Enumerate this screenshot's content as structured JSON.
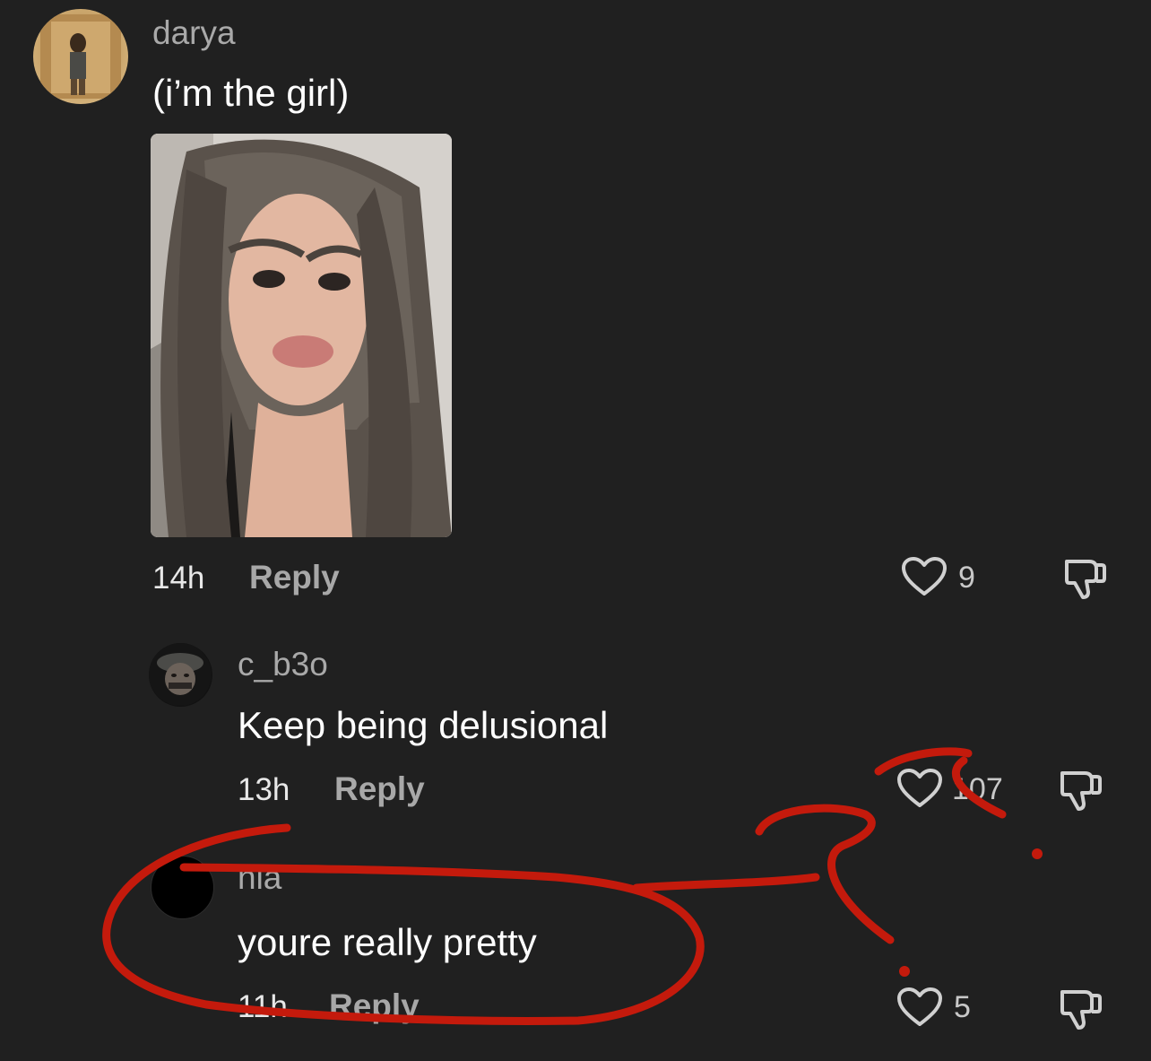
{
  "comments": [
    {
      "username": "darya",
      "text": "(i’m the girl)",
      "time": "14h",
      "reply_label": "Reply",
      "likes": "9",
      "has_photo": true
    },
    {
      "username": "c_b3o",
      "text": "Keep being delusional",
      "time": "13h",
      "reply_label": "Reply",
      "likes": "107"
    },
    {
      "username": "nia",
      "text": "youre really pretty",
      "time": "11h",
      "reply_label": "Reply",
      "likes": "5"
    }
  ],
  "icons": {
    "like": "heart-outline-icon",
    "dislike": "thumbs-down-icon"
  },
  "colors": {
    "background": "#202020",
    "annotation": "#c41a0c",
    "username": "#a9a9a9",
    "reply": "#a8a8a8"
  }
}
